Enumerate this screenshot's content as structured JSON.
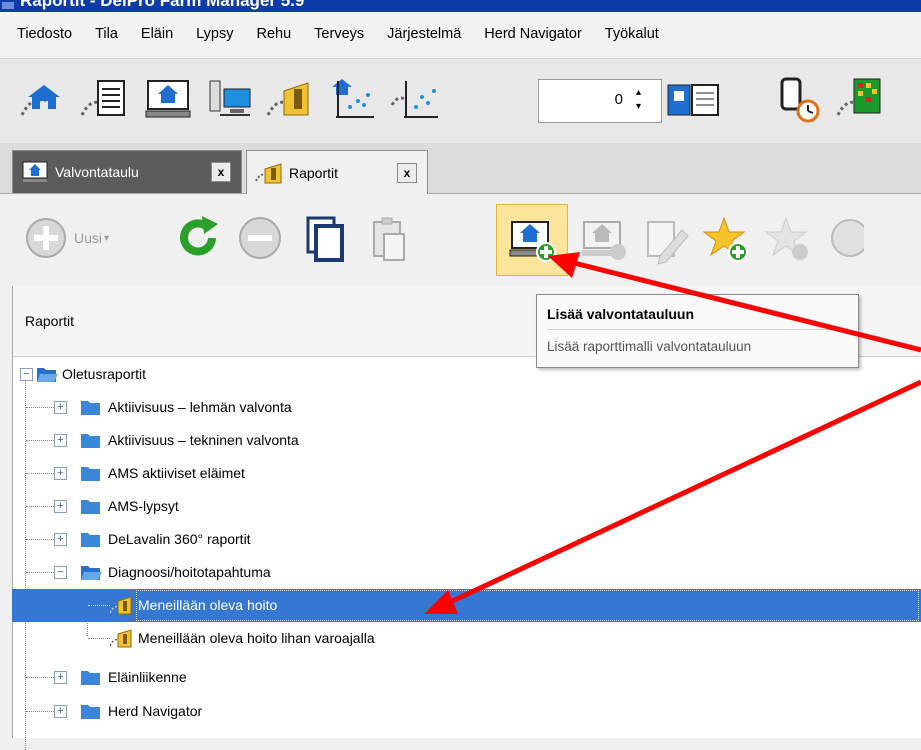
{
  "window": {
    "title": "Raportit - DelPro Farm Manager 5.9"
  },
  "menu": [
    "Tiedosto",
    "Tila",
    "Eläin",
    "Lypsy",
    "Rehu",
    "Terveys",
    "Järjestelmä",
    "Herd Navigator",
    "Työkalut"
  ],
  "spin": {
    "value": "0"
  },
  "tabs": [
    {
      "label": "Valvontataulu",
      "close": "x",
      "active": false
    },
    {
      "label": "Raportit",
      "close": "x",
      "active": true
    }
  ],
  "toolbar2": {
    "new_label": "Uusi",
    "new_arrow": "▾"
  },
  "panel": {
    "header": "Raportit"
  },
  "tooltip": {
    "title": "Lisää valvontatauluun",
    "description": "Lisää raporttimalli valvontatauluun"
  },
  "tree": {
    "root": "Oletusraportit",
    "items": [
      {
        "label": "Aktiivisuus – lehmän valvonta"
      },
      {
        "label": "Aktiivisuus – tekninen valvonta"
      },
      {
        "label": "AMS aktiiviset eläimet"
      },
      {
        "label": "AMS-lypsyt"
      },
      {
        "label": "DeLavalin 360° raportit"
      },
      {
        "label": "Diagnoosi/hoitotapahtuma"
      },
      {
        "label": "Meneillään oleva hoito"
      },
      {
        "label": "Meneillään oleva hoito lihan varoajalla"
      },
      {
        "label": "Eläinliikenne"
      },
      {
        "label": "Herd Navigator"
      }
    ],
    "expander_plus": "+",
    "expander_minus": "−"
  },
  "colors": {
    "selection": "#3478d4",
    "highlight": "#fbe59a",
    "annotation": "#ff0000",
    "title_bar": "#0b3ca8"
  }
}
